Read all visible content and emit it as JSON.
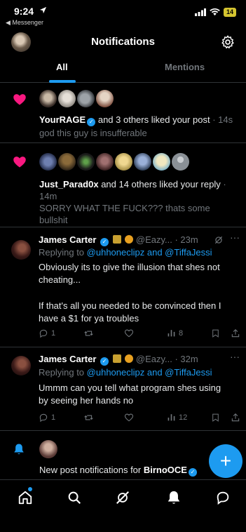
{
  "status_bar": {
    "time": "9:24",
    "back_label": "◀ Messenger",
    "battery": "14"
  },
  "header": {
    "title": "Notifications"
  },
  "tabs": [
    {
      "label": "All",
      "active": true
    },
    {
      "label": "Mentions",
      "active": false
    }
  ],
  "notifications": [
    {
      "type": "like",
      "actor": "YourRAGE",
      "action": "and 3 others liked your post",
      "time": "· 14s",
      "snippet": "god this guy is insufferable",
      "avatar_count": 4
    },
    {
      "type": "like",
      "actor": "Just_Parad0x",
      "action": "and 14 others liked your reply",
      "time": "· 14m",
      "snippet": "SORRY WHAT THE FUCK??? thats some bullshit",
      "avatar_count": 8
    }
  ],
  "tweets": [
    {
      "name": "James Carter",
      "handle": "@Eazy...",
      "time": "· 23m",
      "replying_prefix": "Replying to",
      "replying_to": "@uhhoneclipz and @TiffaJessi",
      "text_line1": "Obviously its to give the illusion that shes not cheating...",
      "text_line2": "If that's all you needed to be convinced then I have a $1 for ya troubles",
      "reply_count": "1",
      "retweet_count": "",
      "like_count": "",
      "view_count": "8"
    },
    {
      "name": "James Carter",
      "handle": "@Eazy...",
      "time": "· 32m",
      "replying_prefix": "Replying to",
      "replying_to": "@uhhoneclipz and @TiffaJessi",
      "text_line1": "Ummm can you tell what program shes using by seeing her hands no",
      "reply_count": "1",
      "retweet_count": "",
      "like_count": "",
      "view_count": "12"
    }
  ],
  "post_notification": {
    "prefix": "New post notifications for",
    "account": "BirnoOCE"
  },
  "colors": {
    "accent": "#1d9bf0",
    "heart": "#f91880",
    "muted": "#71767b",
    "divider": "#2f3336"
  },
  "icons": [
    "location-arrow-icon",
    "signal-icon",
    "wifi-icon",
    "gear-icon",
    "heart-icon",
    "verified-icon",
    "grok-icon",
    "more-icon",
    "reply-icon",
    "retweet-icon",
    "like-icon",
    "views-icon",
    "bookmark-icon",
    "share-icon",
    "bell-icon",
    "plus-icon",
    "home-icon",
    "search-icon",
    "communities-icon",
    "notifications-icon",
    "messages-icon"
  ]
}
